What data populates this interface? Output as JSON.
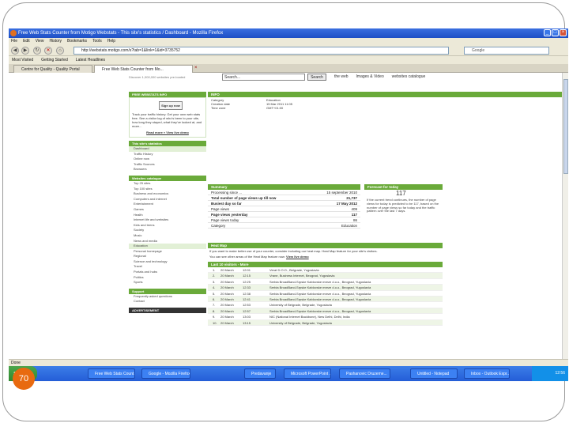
{
  "slide_number": "70",
  "window": {
    "title": "Free Web Stats Counter from Motigo Webstats - This site's statistics / Dashboard - Mozilla Firefox",
    "menu": [
      "File",
      "Edit",
      "View",
      "History",
      "Bookmarks",
      "Tools",
      "Help"
    ],
    "url": "http://webstats.motigo.com/s?tab=1&link=1&id=3735752",
    "search_placeholder": "Google",
    "bookmarks": [
      "Most Visited",
      "Getting Started",
      "Latest Headlines"
    ],
    "tabs": [
      "Centre for Quality - Quality Portal",
      "Free Web Stats Counter from Mo..."
    ],
    "status": "Done"
  },
  "page": {
    "top_note": "Discover 1,000,000 websites pre-loaded",
    "search_input": "Search...",
    "search_button": "Search",
    "search_options": [
      "the web",
      "Images & Video",
      "websites catalogue"
    ],
    "sidebar": {
      "promo_header": "FREE WEBSTATS INFO",
      "signup_label": "Sign up now",
      "promo_text": "Track your traffic history. Get your own web stats free. See a visitor log of who's been to your site, how long they stayed, what they've looked at, and more...",
      "promo_links": "Read more » View live demo",
      "stats_header": "This site's statistics",
      "stats_items": [
        "Dashboard",
        "Traffic History",
        "Online now",
        "Traffic Sources",
        "Browsers"
      ],
      "catalogue_header": "Websites catalogue",
      "catalogue_items": [
        "Top 25 sites",
        "Top 100 sites",
        "Business and economics",
        "Computers and internet",
        "Entertainment",
        "Games",
        "Health",
        "Internet life and websites",
        "Kids and teens",
        "Society",
        "Music",
        "News and media",
        "Education",
        "Personal homepage",
        "Regional",
        "Science and technology",
        "Travel",
        "Portals and hubs",
        "Politics",
        "Sports"
      ],
      "support_header": "Support",
      "support_items": [
        "Frequently asked questions",
        "Contact"
      ],
      "sponsor_header": "ADVERTISEMENT"
    },
    "info": {
      "header": "INFO",
      "labels": [
        "Category",
        "Creation date",
        "Time zone"
      ],
      "values": [
        "Education",
        "15 Mar 2011 11:05",
        "GMT+01:00"
      ]
    },
    "summary": {
      "header": "Summary",
      "rows": [
        {
          "label": "Processing since ...",
          "value": "15 september 2010"
        },
        {
          "label": "Total number of page views up till now",
          "value": "21,737"
        },
        {
          "label": "Busiest day so far",
          "value": "17 May 2012"
        },
        {
          "label": "Page views",
          "value": "409"
        },
        {
          "label": "Page views yesterday",
          "value": "117"
        },
        {
          "label": "Page views today",
          "value": "86"
        },
        {
          "label": "Category",
          "value": "Education"
        }
      ]
    },
    "forecast": {
      "header": "Forecast for today",
      "value": "117",
      "text": "If the current trend continues, the number of page views for today is predicted to be 117, based on the number of page views so far today and the traffic pattern over the last 7 days."
    },
    "heatmap": {
      "header": "Heat Map",
      "text": "If you want to make better use of your counter, consider including our heat map. Heat Map feature for your site's visitors.",
      "link_text": "You can see other areas of the Heat Map feature now:",
      "link": "View live demo"
    },
    "visitors": {
      "header": "Last 10 visitors - More",
      "rows": [
        {
          "n": "1.",
          "date": "20 March",
          "time": "12:01",
          "desc": "Verat D.O.O., Belgrade, Yugoslavia"
        },
        {
          "n": "2.",
          "date": "20 March",
          "time": "12:15",
          "desc": "Vrane, Business Internet, Beograd, Yugoslavia"
        },
        {
          "n": "3.",
          "date": "20 March",
          "time": "12:25",
          "desc": "Serbia BroadBand-Srpske Kablovske mreze d.o.o., Beograd, Yugoslavia"
        },
        {
          "n": "4.",
          "date": "20 March",
          "time": "12:33",
          "desc": "Serbia BroadBand-Srpske Kablovske mreze d.o.o., Beograd, Yugoslavia"
        },
        {
          "n": "5.",
          "date": "20 March",
          "time": "12:38",
          "desc": "Serbia BroadBand-Srpske Kablovske mreze d.o.o., Beograd, Yugoslavia"
        },
        {
          "n": "6.",
          "date": "20 March",
          "time": "12:41",
          "desc": "Serbia BroadBand-Srpske Kablovske mreze d.o.o., Beograd, Yugoslavia"
        },
        {
          "n": "7.",
          "date": "20 March",
          "time": "12:53",
          "desc": "University of Belgrade, Belgrade, Yugoslavia"
        },
        {
          "n": "8.",
          "date": "20 March",
          "time": "12:57",
          "desc": "Serbia BroadBand-Srpske Kablovske mreze d.o.o., Beograd, Yugoslavia"
        },
        {
          "n": "9.",
          "date": "20 March",
          "time": "13:03",
          "desc": "NIC (National Internet Backbone), New Delhi, Delhi, India"
        },
        {
          "n": "10.",
          "date": "20 March",
          "time": "13:15",
          "desc": "University of Belgrade, Belgrade, Yugoslavia"
        }
      ]
    }
  },
  "taskbar": {
    "start": "start",
    "buttons": [
      "Free Web Stats Count...",
      "Google - Mozilla Firefox",
      "Predavanje",
      "Microsoft PowerPoint ...",
      "Pashanovic Druzeme...",
      "Untitled - Notepad",
      "Inbox - Outlook Expr..."
    ],
    "clock": "12:56"
  }
}
